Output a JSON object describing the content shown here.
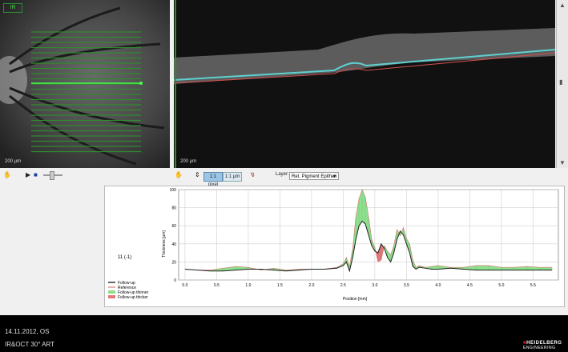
{
  "fundus": {
    "label": "IR",
    "scale": "200 µm"
  },
  "oct": {
    "scale": "200 µm"
  },
  "toolbar": {
    "btn_pixel": "1:1 pixel",
    "btn_um": "1:1 µm",
    "layer_label": "Layer:",
    "layer_value": "Ret. Pigment Epitheli"
  },
  "chart_data": {
    "type": "line",
    "xlabel": "Position [mm]",
    "ylabel": "Thickness [µm]",
    "annotation": "11 (-1)",
    "xlim": [
      -0.1,
      5.9
    ],
    "ylim": [
      0,
      100
    ],
    "xticks": [
      "0.0",
      "0.5",
      "1.0",
      "1.5",
      "2.0",
      "2.5",
      "3.0",
      "3.5",
      "4.0",
      "4.5",
      "5.0",
      "5.5"
    ],
    "yticks": [
      "0",
      "20",
      "40",
      "60",
      "80",
      "100"
    ],
    "grid": true,
    "legend_position": "left",
    "legend": [
      {
        "label": "Follow-up",
        "color": "#000000"
      },
      {
        "label": "Reference",
        "color": "#e07a7a"
      },
      {
        "label": "Follow-up thinner",
        "color": "#8ee08e"
      },
      {
        "label": "Follow-up thicker",
        "color": "#e07a7a"
      }
    ],
    "x": [
      0.0,
      0.2,
      0.4,
      0.6,
      0.8,
      1.0,
      1.2,
      1.4,
      1.6,
      1.8,
      2.0,
      2.2,
      2.4,
      2.5,
      2.55,
      2.6,
      2.65,
      2.7,
      2.75,
      2.8,
      2.85,
      2.9,
      2.95,
      3.0,
      3.05,
      3.1,
      3.15,
      3.2,
      3.25,
      3.3,
      3.35,
      3.4,
      3.45,
      3.5,
      3.55,
      3.6,
      3.65,
      3.7,
      3.8,
      3.9,
      4.0,
      4.2,
      4.4,
      4.6,
      4.8,
      5.0,
      5.2,
      5.4,
      5.6,
      5.8
    ],
    "series": [
      {
        "name": "Follow-up",
        "values": [
          12,
          11,
          10,
          10,
          11,
          12,
          12,
          11,
          10,
          11,
          12,
          12,
          13,
          16,
          20,
          10,
          25,
          45,
          60,
          65,
          62,
          50,
          38,
          32,
          30,
          40,
          35,
          25,
          20,
          30,
          45,
          54,
          50,
          40,
          30,
          15,
          12,
          14,
          13,
          12,
          12,
          13,
          12,
          11,
          11,
          11,
          11,
          11,
          11,
          11
        ]
      },
      {
        "name": "Reference",
        "values": [
          12,
          11,
          11,
          13,
          15,
          14,
          11,
          13,
          11,
          12,
          12,
          12,
          14,
          18,
          25,
          15,
          35,
          70,
          90,
          100,
          92,
          70,
          45,
          36,
          20,
          22,
          38,
          32,
          28,
          38,
          56,
          49,
          58,
          46,
          40,
          22,
          14,
          16,
          14,
          15,
          16,
          14,
          14,
          16,
          16,
          14,
          14,
          15,
          14,
          14
        ]
      }
    ]
  },
  "footer": {
    "date_eye": "14.11.2012, OS",
    "modality": "IR&OCT 30° ART",
    "brand_line1": "HEIDELBERG",
    "brand_line2": "ENGINEERING"
  },
  "colors": {
    "accent_green": "#2e8b2e",
    "thinner": "#8ee08e",
    "thicker": "#e07a7a",
    "brand_red": "#d42020"
  }
}
